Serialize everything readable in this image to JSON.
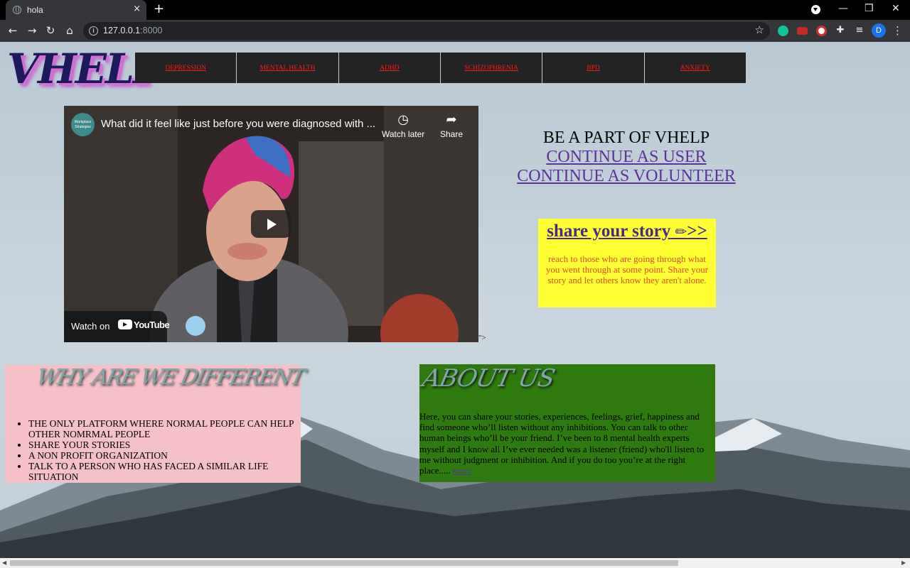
{
  "browser": {
    "tab_title": "hola",
    "tab_close": "×",
    "new_tab": "+",
    "url_host": "127.0.0.1",
    "url_port": ":8000",
    "avatar_letter": "D",
    "minimize": "—",
    "maximize": "❐",
    "close": "✕"
  },
  "site": {
    "logo": "VHELP",
    "nav": [
      "DEPRESSION",
      "MENTAL HEALTH",
      "ADHD",
      "SCHIZOPHRENIA",
      "BPD",
      "ANXIETY"
    ]
  },
  "video": {
    "channel_badge": "Workplace Strategies",
    "title": "What did it feel like just before you were diagnosed with ...",
    "watch_later": "Watch later",
    "share": "Share",
    "watch_on": "Watch on",
    "youtube": "YouTube",
    "stray_text": "\">"
  },
  "cta": {
    "heading": "BE A PART OF VHELP",
    "user_link": "CONTINUE AS USER",
    "volunteer_link": "CONTINUE AS VOLUNTEER"
  },
  "story": {
    "title": "share your story",
    "arrows": ">>",
    "body": "reach to those who are going through what you went through at some point. Share your story and let others know they aren't alone."
  },
  "why": {
    "heading": "WHY ARE WE DIFFERENT",
    "items": [
      "THE ONLY PLATFORM WHERE NORMAL PEOPLE CAN HELP OTHER NOMRMAL PEOPLE",
      "SHARE YOUR STORIES",
      "A NON PROFIT ORGANIZATION",
      "TALK TO A PERSON WHO HAS FACED A SIMILAR LIFE SITUATION"
    ]
  },
  "about": {
    "heading": "ABOUT US",
    "body": "Here, you can share your stories, experiences, feelings, grief, happiness and find someone who’ll listen without any inhibitions. You can talk to other human beings who’ll be your friend. I’ve been to 8 mental health experts myself and I know all I’ve ever needed was a listener (friend) who'll listen to me without judgment or inhibition. And if you do too you’re at the right place.....",
    "more_link": "more"
  },
  "colors": {
    "nav_bg": "#222222",
    "nav_link": "#ff1a1a",
    "story_bg": "#ffff33",
    "why_bg": "#f6c0c8",
    "about_bg": "#2f7a0f",
    "link_visited": "#5c3399"
  }
}
